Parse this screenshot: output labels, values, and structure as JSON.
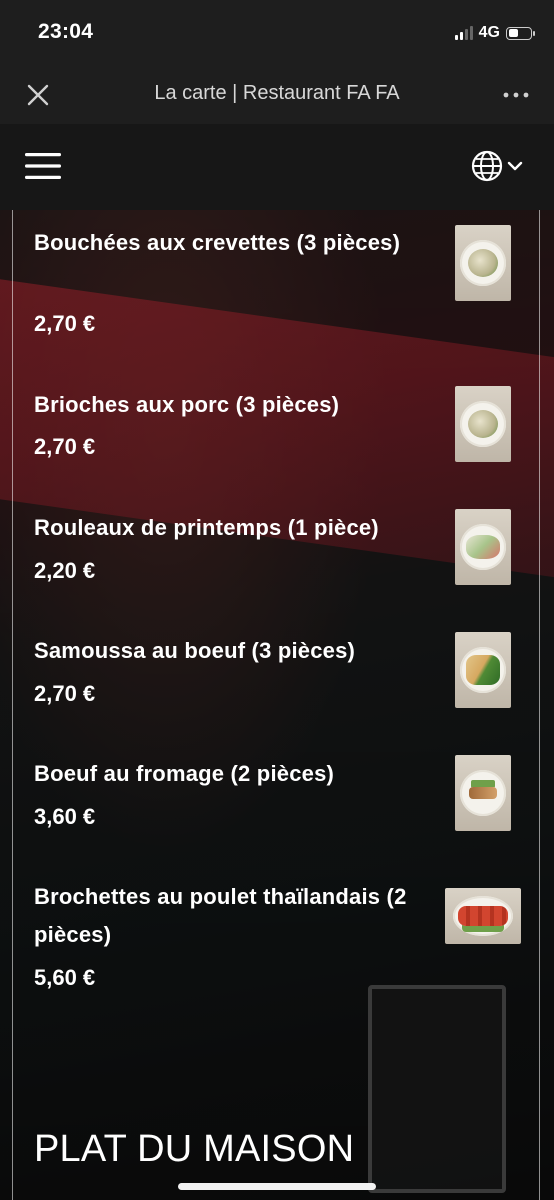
{
  "status_bar": {
    "time": "23:04",
    "network": "4G",
    "signal_bars": 2,
    "battery_level": 0.45
  },
  "title_bar": {
    "title": "La carte | Restaurant FA FA"
  },
  "header": {
    "menu_icon": "hamburger-menu-icon",
    "language_icon": "globe-icon"
  },
  "menu": {
    "items": [
      {
        "name": "Bouchées aux crevettes (3 pièces)",
        "price": "2,70 €"
      },
      {
        "name": "Brioches aux porc (3 pièces)",
        "price": "2,70 €"
      },
      {
        "name": "Rouleaux de printemps (1 pièce)",
        "price": "2,20 €"
      },
      {
        "name": "Samoussa au boeuf (3 pièces)",
        "price": "2,70 €"
      },
      {
        "name": "Boeuf au fromage (2 pièces)",
        "price": "3,60 €"
      },
      {
        "name": "Brochettes au poulet thaïlandais (2 pièces)",
        "price": "5,60 €"
      }
    ],
    "section_title": "PLAT DU MAISON"
  }
}
